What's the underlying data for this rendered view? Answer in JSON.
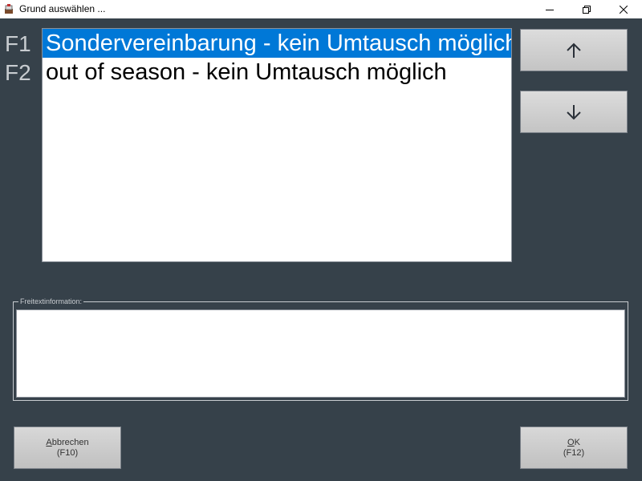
{
  "window": {
    "title": "Grund auswählen ..."
  },
  "fkeys": [
    "F1",
    "F2"
  ],
  "reasons": [
    {
      "label": "Sondervereinbarung - kein Umtausch möglich",
      "selected": true
    },
    {
      "label": "out of season - kein Umtausch möglich",
      "selected": false
    }
  ],
  "freetext": {
    "legend": "Freitextinformation:",
    "value": ""
  },
  "buttons": {
    "cancel": {
      "accel": "A",
      "rest": "bbrechen",
      "shortcut": "(F10)"
    },
    "ok": {
      "accel": "O",
      "rest": "K",
      "shortcut": "(F12)"
    }
  },
  "icons": {
    "up": "arrow-up-icon",
    "down": "arrow-down-icon"
  },
  "colors": {
    "background": "#36414a",
    "selection": "#0078d7"
  }
}
